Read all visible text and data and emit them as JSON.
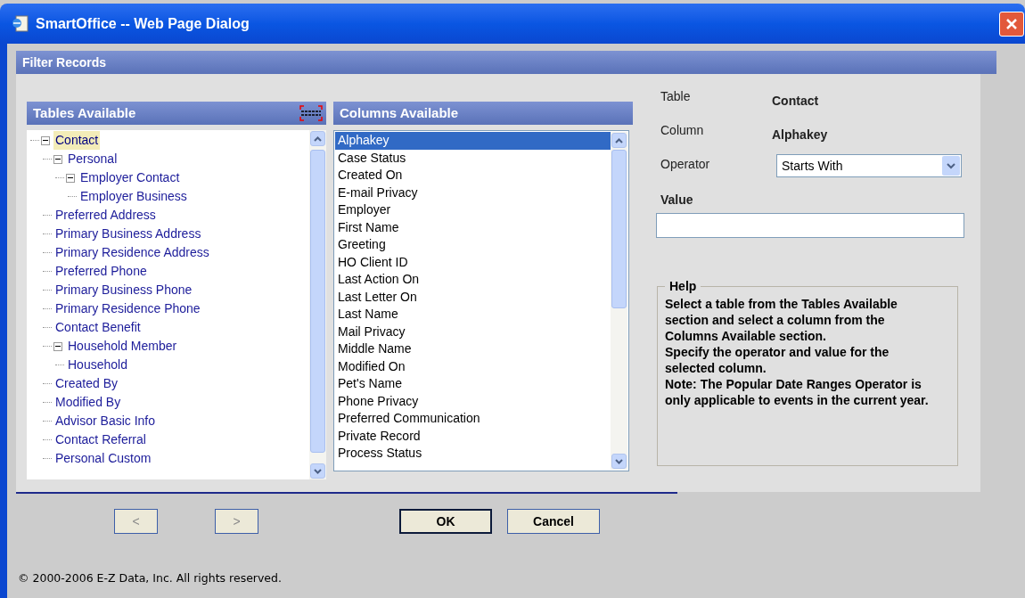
{
  "window": {
    "title": "SmartOffice -- Web Page Dialog"
  },
  "header": "Filter Records",
  "tables": {
    "title": "Tables Available",
    "tree": [
      {
        "label": "Contact",
        "selected": true,
        "expanded": true,
        "children": [
          {
            "label": "Personal",
            "selected": false,
            "expanded": true,
            "children": [
              {
                "label": "Employer Contact",
                "selected": false,
                "expanded": true,
                "children": [
                  {
                    "label": "Employer Business",
                    "selected": false
                  }
                ]
              }
            ]
          },
          {
            "label": "Preferred Address",
            "selected": false
          },
          {
            "label": "Primary Business Address",
            "selected": false
          },
          {
            "label": "Primary Residence Address",
            "selected": false
          },
          {
            "label": "Preferred Phone",
            "selected": false
          },
          {
            "label": "Primary Business Phone",
            "selected": false
          },
          {
            "label": "Primary Residence Phone",
            "selected": false
          },
          {
            "label": "Contact Benefit",
            "selected": false
          },
          {
            "label": "Household Member",
            "selected": false,
            "expanded": true,
            "children": [
              {
                "label": "Household",
                "selected": false
              }
            ]
          },
          {
            "label": "Created By",
            "selected": false
          },
          {
            "label": "Modified By",
            "selected": false
          },
          {
            "label": "Advisor Basic Info",
            "selected": false
          },
          {
            "label": "Contact Referral",
            "selected": false
          },
          {
            "label": "Personal Custom",
            "selected": false
          }
        ]
      }
    ]
  },
  "columns": {
    "title": "Columns Available",
    "items": [
      {
        "label": "Alphakey",
        "selected": true
      },
      {
        "label": "Case Status",
        "selected": false
      },
      {
        "label": "Created On",
        "selected": false
      },
      {
        "label": "E-mail Privacy",
        "selected": false
      },
      {
        "label": "Employer",
        "selected": false
      },
      {
        "label": "First Name",
        "selected": false
      },
      {
        "label": "Greeting",
        "selected": false
      },
      {
        "label": "HO Client ID",
        "selected": false
      },
      {
        "label": "Last Action On",
        "selected": false
      },
      {
        "label": "Last Letter On",
        "selected": false
      },
      {
        "label": "Last Name",
        "selected": false
      },
      {
        "label": "Mail Privacy",
        "selected": false
      },
      {
        "label": "Middle Name",
        "selected": false
      },
      {
        "label": "Modified On",
        "selected": false
      },
      {
        "label": "Pet's Name",
        "selected": false
      },
      {
        "label": "Phone Privacy",
        "selected": false
      },
      {
        "label": "Preferred Communication",
        "selected": false
      },
      {
        "label": "Private Record",
        "selected": false
      },
      {
        "label": "Process Status",
        "selected": false
      }
    ]
  },
  "details": {
    "table_label": "Table",
    "table_value": "Contact",
    "column_label": "Column",
    "column_value": "Alphakey",
    "operator_label": "Operator",
    "operator_value": "Starts With",
    "value_label": "Value"
  },
  "help": {
    "title": "Help",
    "lines": [
      "Select a table from the Tables Available section and select a column from the Columns Available section.",
      "Specify the operator and value for the selected column.",
      "Note: The Popular Date Ranges Operator is only applicable to events in the current year."
    ]
  },
  "buttons": [
    {
      "label": "<",
      "disabled": true,
      "default": false
    },
    {
      "label": ">",
      "disabled": true,
      "default": false
    },
    {
      "label": "OK",
      "disabled": false,
      "default": true
    },
    {
      "label": "Cancel",
      "disabled": false,
      "default": false
    }
  ],
  "footer": "© 2000-2006 E-Z Data, Inc. All rights reserved."
}
